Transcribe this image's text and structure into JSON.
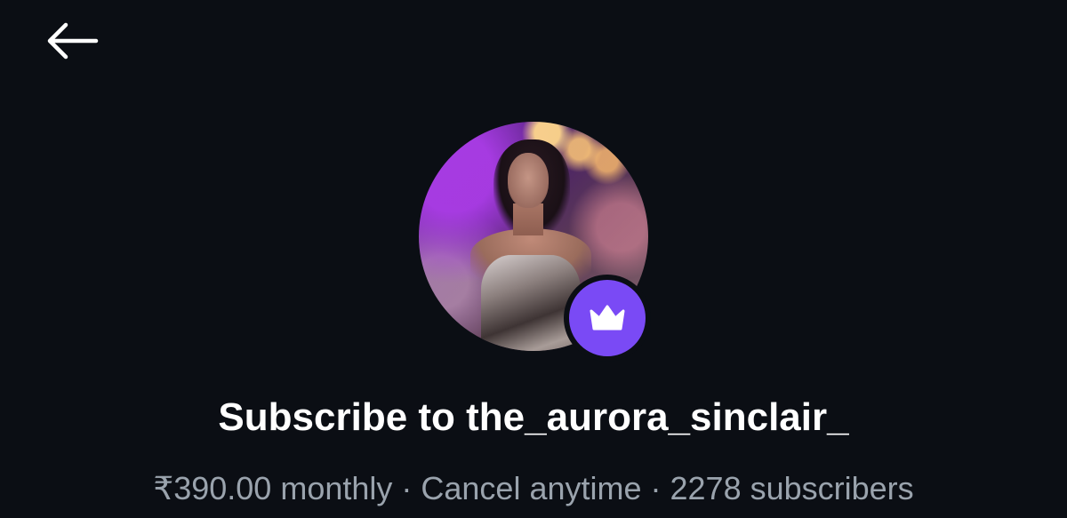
{
  "header": {
    "back_icon": "arrow-left-icon"
  },
  "profile": {
    "avatar_alt": "the_aurora_sinclair_",
    "badge_icon": "crown-icon",
    "badge_color": "#7a4af5"
  },
  "subscribe": {
    "title": "Subscribe to the_aurora_sinclair_",
    "price": "₹390.00 monthly",
    "cancel": "Cancel anytime",
    "subscribers": "2278 subscribers",
    "separator": "·"
  },
  "colors": {
    "background": "#0b0e14",
    "title": "#ffffff",
    "subtext": "#9aa3ad"
  }
}
